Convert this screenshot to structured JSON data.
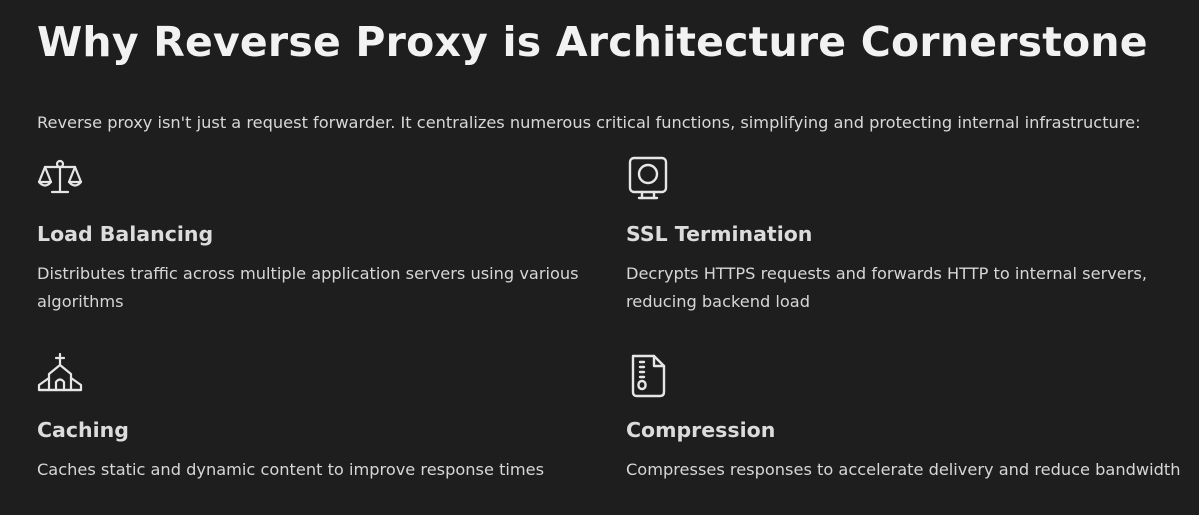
{
  "page": {
    "title": "Why Reverse Proxy is Architecture Cornerstone",
    "intro": "Reverse proxy isn't just a request forwarder. It centralizes numerous critical functions, simplifying and protecting internal infrastructure:"
  },
  "features": [
    {
      "icon": "scale-icon",
      "title": "Load Balancing",
      "description": "Distributes traffic across multiple application servers using various algorithms"
    },
    {
      "icon": "ssl-lock-icon",
      "title": "SSL Termination",
      "description": "Decrypts HTTPS requests and forwards HTTP to internal servers, reducing backend load"
    },
    {
      "icon": "building-icon",
      "title": "Caching",
      "description": "Caches static and dynamic content to improve response times"
    },
    {
      "icon": "compressed-file-icon",
      "title": "Compression",
      "description": "Compresses responses to accelerate delivery and reduce bandwidth"
    }
  ],
  "colors": {
    "background": "#1e1e1e",
    "text": "#e6e6e6"
  }
}
